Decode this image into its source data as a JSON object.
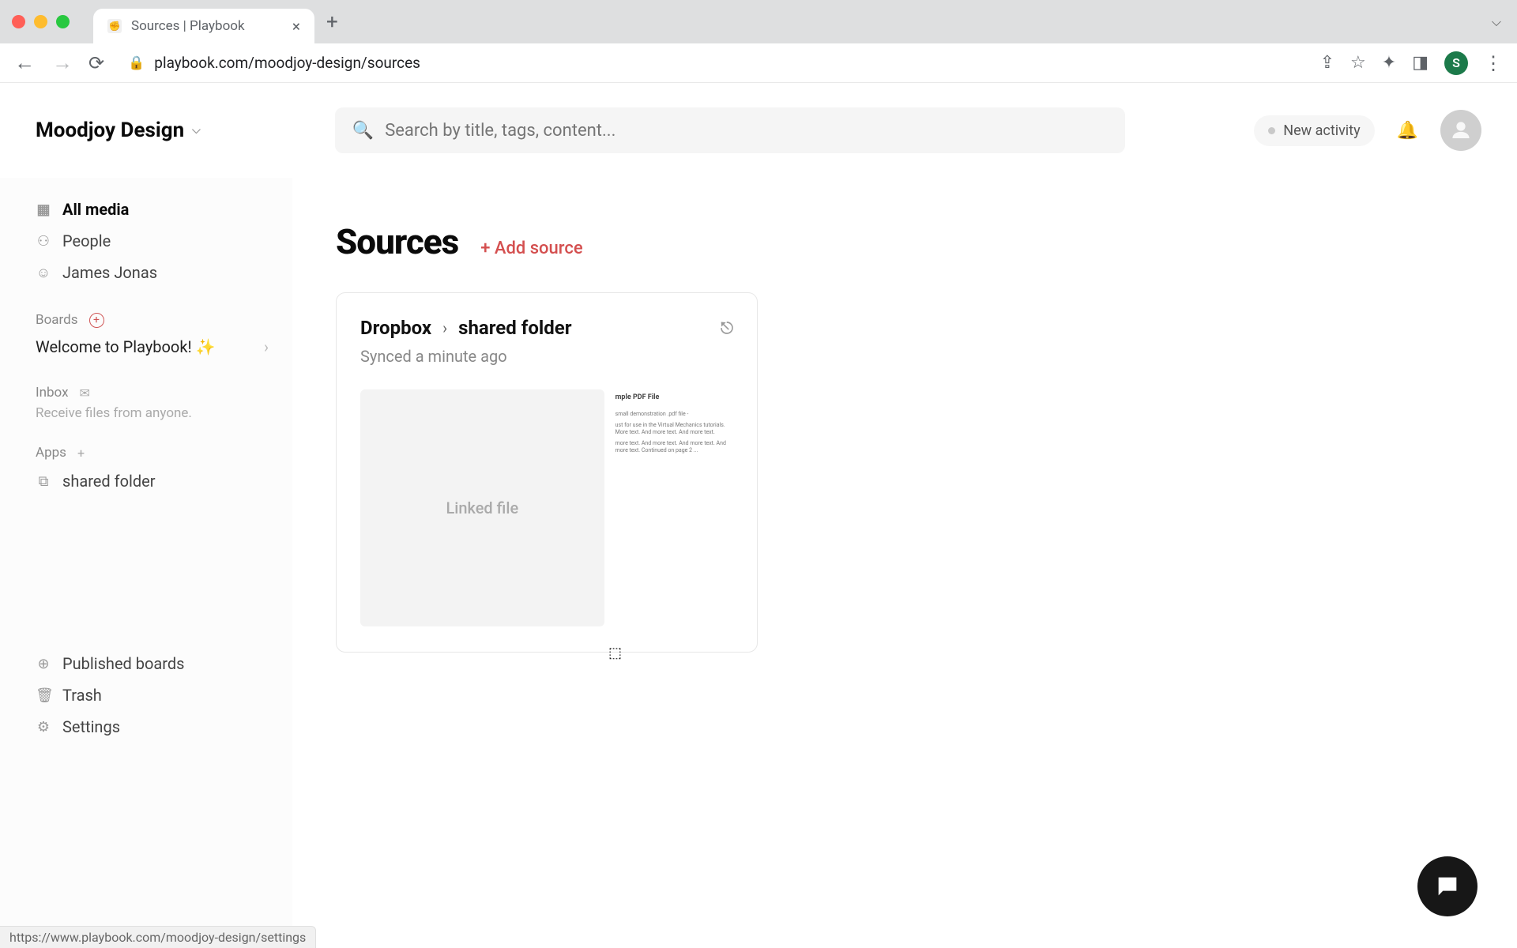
{
  "browser": {
    "tab_title": "Sources | Playbook",
    "url": "playbook.com/moodjoy-design/sources",
    "chrome_avatar": "S"
  },
  "header": {
    "workspace": "Moodjoy Design",
    "search_placeholder": "Search by title, tags, content...",
    "new_activity": "New activity"
  },
  "sidebar": {
    "top": [
      {
        "icon": "⊞",
        "label": "All media",
        "bold": true
      },
      {
        "icon": "◯",
        "label": "People",
        "bold": false
      },
      {
        "icon": "☺",
        "label": "James Jonas",
        "bold": false
      }
    ],
    "boards_label": "Boards",
    "board_item": "Welcome to Playbook! ✨",
    "inbox_label": "Inbox",
    "inbox_sub": "Receive files from anyone.",
    "apps_label": "Apps",
    "apps_item": "shared folder",
    "lower": [
      {
        "icon": "⊕",
        "label": "Published boards"
      },
      {
        "icon": "🗑",
        "label": "Trash"
      },
      {
        "icon": "⚙",
        "label": "Settings"
      }
    ]
  },
  "main": {
    "title": "Sources",
    "add_source": "+ Add source",
    "card": {
      "origin": "Dropbox",
      "folder": "shared folder",
      "synced": "Synced a minute ago",
      "linked_file": "Linked file",
      "pdf_title": "mple PDF File"
    }
  },
  "status_url": "https://www.playbook.com/moodjoy-design/settings"
}
